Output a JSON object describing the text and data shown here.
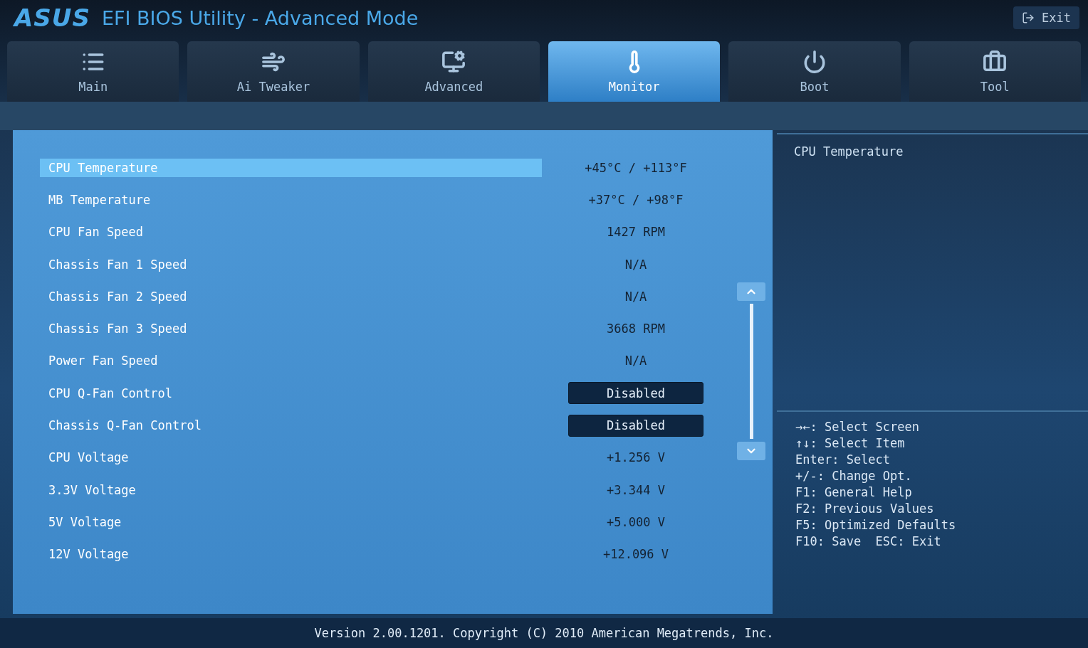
{
  "header": {
    "logo": "ASUS",
    "title": "EFI BIOS Utility - Advanced Mode",
    "exit_button": "Exit"
  },
  "tabs": [
    {
      "label": "Main",
      "selected": false
    },
    {
      "label": "Ai Tweaker",
      "selected": false
    },
    {
      "label": "Advanced",
      "selected": false
    },
    {
      "label": "Monitor",
      "selected": true
    },
    {
      "label": "Boot",
      "selected": false
    },
    {
      "label": "Tool",
      "selected": false
    }
  ],
  "items": [
    {
      "label": "CPU Temperature",
      "kind": "reading",
      "value": "+45°C / +113°F",
      "selected": true
    },
    {
      "label": "MB Temperature",
      "kind": "reading",
      "value": "+37°C / +98°F",
      "selected": false
    },
    {
      "label": "CPU Fan Speed",
      "kind": "reading",
      "value": "1427 RPM",
      "selected": false
    },
    {
      "label": "Chassis Fan 1 Speed",
      "kind": "reading",
      "value": "N/A",
      "selected": false
    },
    {
      "label": "Chassis Fan 2 Speed",
      "kind": "reading",
      "value": "N/A",
      "selected": false
    },
    {
      "label": "Chassis Fan 3 Speed",
      "kind": "reading",
      "value": "3668 RPM",
      "selected": false
    },
    {
      "label": "Power Fan Speed",
      "kind": "reading",
      "value": "N/A",
      "selected": false
    },
    {
      "label": "CPU Q-Fan Control",
      "kind": "option",
      "value": "Disabled",
      "selected": false
    },
    {
      "label": "Chassis Q-Fan Control",
      "kind": "option",
      "value": "Disabled",
      "selected": false
    },
    {
      "label": "CPU Voltage",
      "kind": "reading",
      "value": "+1.256 V",
      "selected": false
    },
    {
      "label": "3.3V Voltage",
      "kind": "reading",
      "value": "+3.344 V",
      "selected": false
    },
    {
      "label": "5V Voltage",
      "kind": "reading",
      "value": "+5.000 V",
      "selected": false
    },
    {
      "label": "12V Voltage",
      "kind": "reading",
      "value": "+12.096 V",
      "selected": false
    }
  ],
  "help": {
    "description": "CPU Temperature",
    "keys": [
      "→←: Select Screen",
      "↑↓: Select Item",
      "Enter: Select",
      "+/-: Change Opt.",
      "F1: General Help",
      "F2: Previous Values",
      "F5: Optimized Defaults",
      "F10: Save  ESC: Exit"
    ]
  },
  "status_bar": "Version 2.00.1201. Copyright (C) 2010 American Megatrends, Inc."
}
